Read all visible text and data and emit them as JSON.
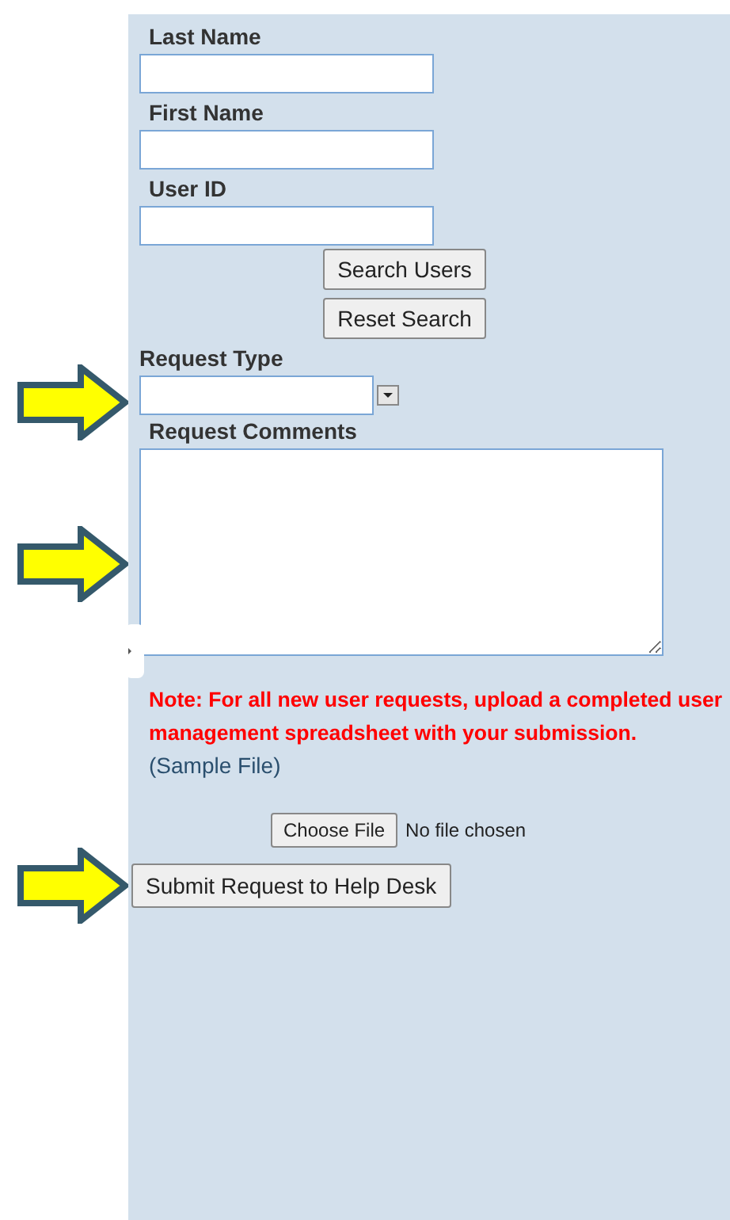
{
  "fields": [
    {
      "label": "Last Name"
    },
    {
      "label": "First Name"
    },
    {
      "label": "User ID"
    }
  ],
  "search_buttons": [
    "Search Users",
    "Reset Search"
  ],
  "request_type": {
    "label": "Request Type"
  },
  "comments": {
    "label": "Request Comments"
  },
  "note": "Note: For all new user requests, upload a completed user management spreadsheet with your submission.",
  "sample_link": "(Sample File)",
  "file": {
    "button": "Choose File",
    "status": "No file chosen"
  },
  "submit": "Submit Request to Help Desk"
}
